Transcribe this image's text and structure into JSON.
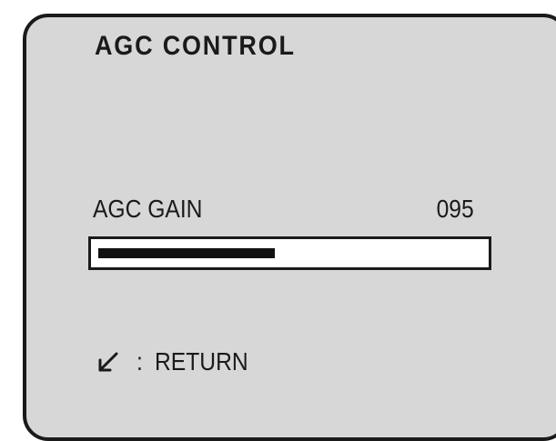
{
  "osd": {
    "title": "AGC CONTROL",
    "gain": {
      "label": "AGC GAIN",
      "value": "095",
      "level_fraction": 0.46
    },
    "footer": {
      "icon": "enter-arrow-icon",
      "separator": ":",
      "label": "RETURN"
    }
  },
  "colors": {
    "panel_background": "#d7d7d7",
    "border": "#1a1a1a",
    "bar_background": "#ffffff",
    "bar_fill": "#111111"
  }
}
